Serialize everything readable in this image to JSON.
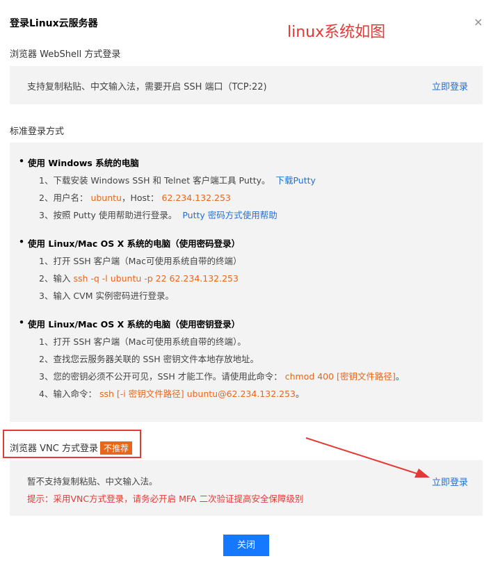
{
  "dialog": {
    "title": "登录Linux云服务器",
    "annotation": "linux系统如图",
    "close_icon": "×"
  },
  "webshell": {
    "label": "浏览器 WebShell 方式登录",
    "description": "支持复制粘贴、中文输入法，需要开启 SSH 端口（TCP:22)",
    "login_link": "立即登录"
  },
  "standard": {
    "label": "标准登录方式",
    "windows": {
      "title": "使用 Windows 系统的电脑",
      "step1_text": "1、下载安装 Windows SSH 和 Telnet 客户端工具 Putty。",
      "step1_link": "下载Putty",
      "step2_prefix": "2、用户名：",
      "step2_user": "ubuntu",
      "step2_mid": "，Host：",
      "step2_host": "62.234.132.253",
      "step3_text": "3、按照 Putty 使用帮助进行登录。",
      "step3_link": "Putty 密码方式使用帮助"
    },
    "mac_password": {
      "title": "使用 Linux/Mac OS X 系统的电脑（使用密码登录）",
      "step1": "1、打开 SSH 客户端（Mac可使用系统自带的终端）",
      "step2_prefix": "2、输入",
      "step2_cmd": "ssh -q -l ubuntu -p 22 62.234.132.253",
      "step3": "3、输入 CVM 实例密码进行登录。"
    },
    "mac_key": {
      "title": "使用 Linux/Mac OS X 系统的电脑（使用密钥登录）",
      "step1": "1、打开 SSH 客户端（Mac可使用系统自带的终端）。",
      "step2": "2、查找您云服务器关联的 SSH 密钥文件本地存放地址。",
      "step3_prefix": "3、您的密钥必须不公开可见，SSH 才能工作。请使用此命令：",
      "step3_cmd": "chmod 400 [密钥文件路径]",
      "step3_suffix": "。",
      "step4_prefix": "4、输入命令：",
      "step4_cmd": "ssh [-i 密钥文件路径] ubuntu@62.234.132.253",
      "step4_suffix": "。"
    }
  },
  "vnc": {
    "label": "浏览器 VNC 方式登录",
    "badge": "不推荐",
    "description": "暂不支持复制粘贴、中文输入法。",
    "warning": "提示：采用VNC方式登录，请务必开启 MFA 二次验证提高安全保障级别",
    "login_link": "立即登录"
  },
  "footer": {
    "close_button": "关闭"
  },
  "colors": {
    "link": "#1f6fd6",
    "highlight": "#e8661a",
    "annotation": "#e53935",
    "primary_button": "#1677ff",
    "panel_bg": "#f3f3f3"
  }
}
